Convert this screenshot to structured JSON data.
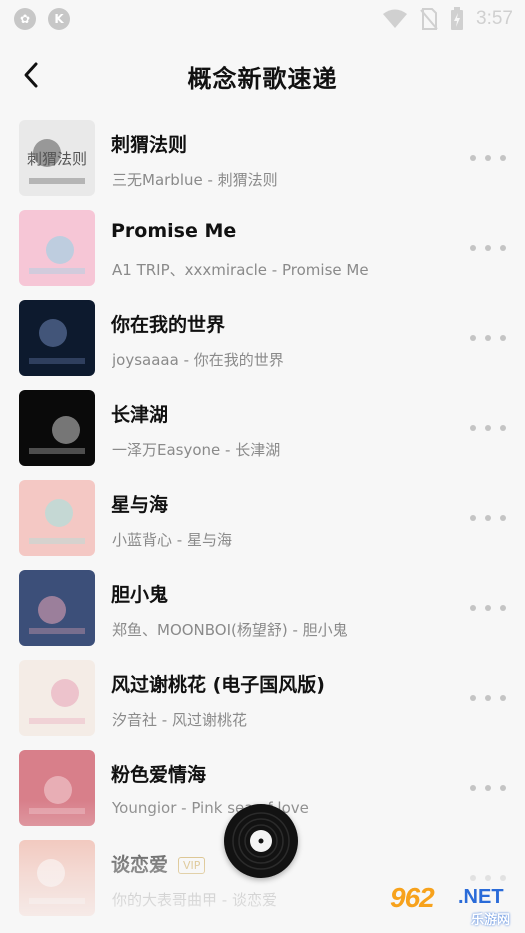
{
  "status_bar": {
    "time": "3:57",
    "left_icons": [
      "app-icon",
      "k-icon"
    ],
    "right_icons": [
      "wifi-icon",
      "no-sim-icon",
      "battery-charging-icon"
    ]
  },
  "header": {
    "title": "概念新歌速递",
    "back_icon": "chevron-left-icon"
  },
  "songs": [
    {
      "title": "刺猬法则",
      "subtitle": "三无Marblue - 刺猬法则",
      "vip": ""
    },
    {
      "title": "Promise Me",
      "subtitle": "A1 TRIP、xxxmiracle - Promise Me",
      "vip": ""
    },
    {
      "title": "你在我的世界",
      "subtitle": "joysaaaa - 你在我的世界",
      "vip": ""
    },
    {
      "title": "长津湖",
      "subtitle": "一泽万Easyone - 长津湖",
      "vip": ""
    },
    {
      "title": "星与海",
      "subtitle": "小蓝背心 - 星与海",
      "vip": ""
    },
    {
      "title": "胆小鬼",
      "subtitle": "郑鱼、MOONBOI(杨望舒) - 胆小鬼",
      "vip": ""
    },
    {
      "title": "风过谢桃花 (电子国风版)",
      "subtitle": "汐音社 - 风过谢桃花",
      "vip": ""
    },
    {
      "title": "粉色爱情海",
      "subtitle": "Youngior - Pink sea of love",
      "vip": ""
    },
    {
      "title": "谈恋爱",
      "subtitle": "你的大表哥曲甲 - 谈恋爱",
      "vip": "VIP"
    }
  ],
  "covers": [
    {
      "bg": "#e9e9e9",
      "accent": "#555555",
      "text": "刺猬法则"
    },
    {
      "bg": "#f6c6d6",
      "accent": "#8fd3e8",
      "text": ""
    },
    {
      "bg": "#0d1a2e",
      "accent": "#6f86b8",
      "text": ""
    },
    {
      "bg": "#0a0a0a",
      "accent": "#cfcfcf",
      "text": ""
    },
    {
      "bg": "#f4c8c4",
      "accent": "#9ee6e2",
      "text": ""
    },
    {
      "bg": "#3c4f79",
      "accent": "#e9a8b8",
      "text": ""
    },
    {
      "bg": "#f4ece6",
      "accent": "#e8a3b6",
      "text": ""
    },
    {
      "bg": "#d87f8a",
      "accent": "#f6d5d8",
      "text": ""
    },
    {
      "bg": "#f0b6a8",
      "accent": "#ffffff",
      "text": ""
    }
  ],
  "player": {
    "icon": "vinyl-record-icon"
  },
  "watermark": {
    "number": "962",
    "suffix": ".NET",
    "text": "乐游网"
  },
  "colors": {
    "background": "#f7f7f7",
    "title": "#111111",
    "subtitle": "#8a8a8a",
    "more_dots": "#c4c4c4",
    "vip": "#c9a24a"
  }
}
